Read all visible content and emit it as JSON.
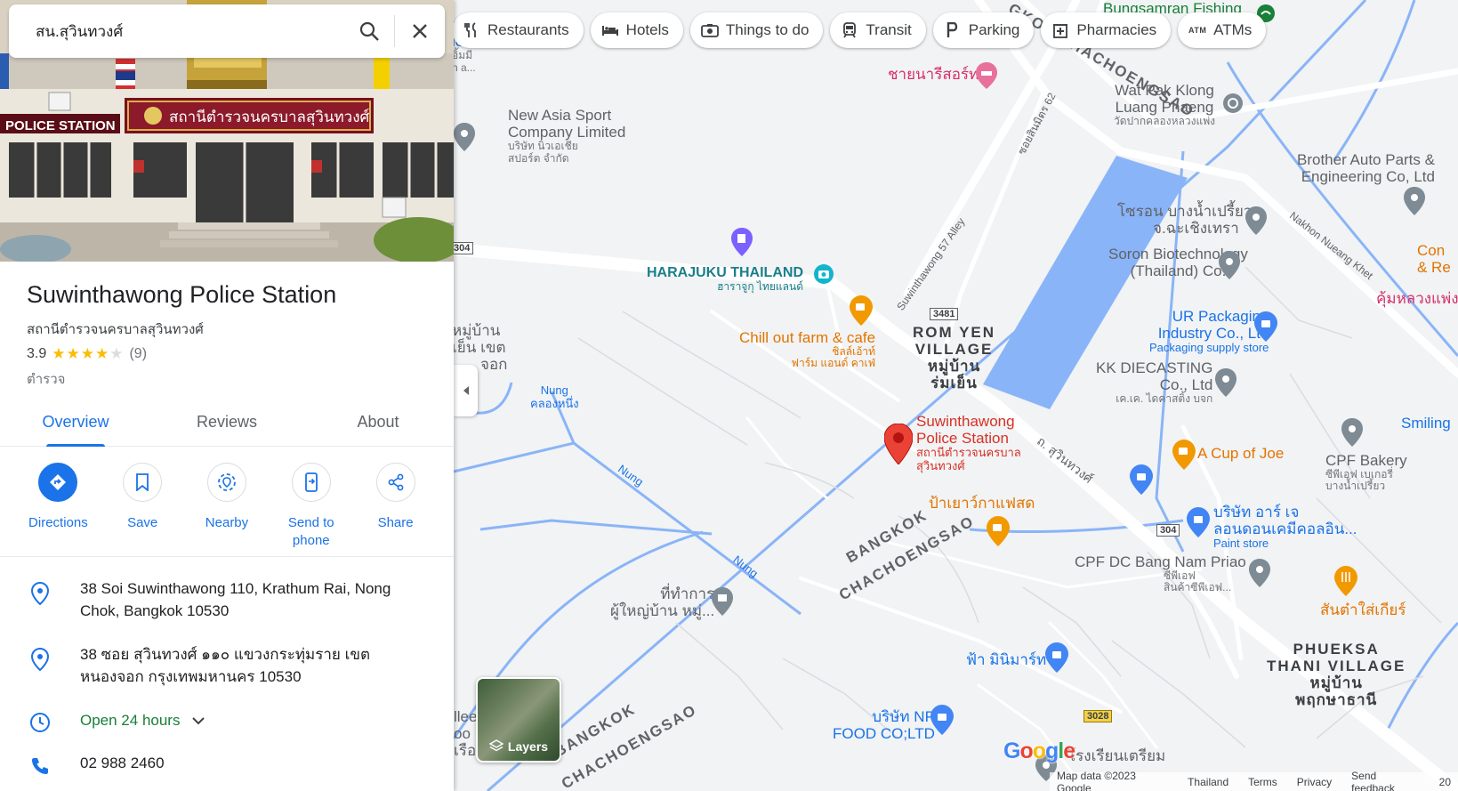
{
  "search": {
    "query": "สน.สุวินทวงศ์"
  },
  "chips": [
    {
      "label": "Restaurants",
      "icon": "restaurant-icon"
    },
    {
      "label": "Hotels",
      "icon": "hotel-icon"
    },
    {
      "label": "Things to do",
      "icon": "camera-icon"
    },
    {
      "label": "Transit",
      "icon": "transit-icon"
    },
    {
      "label": "Parking",
      "icon": "parking-icon"
    },
    {
      "label": "Pharmacies",
      "icon": "pharmacy-icon"
    },
    {
      "label": "ATMs",
      "icon": "atm-icon",
      "icon_text": "ATM"
    }
  ],
  "photo": {
    "sign_th": "สถานีตำรวจนครบาลสุวินทวงศ์",
    "sign_en": "POLICE STATION"
  },
  "place": {
    "title": "Suwinthawong Police Station",
    "subtitle": "สถานีตำรวจนครบาลสุวินทวงศ์",
    "rating": "3.9",
    "stars": 3.9,
    "reviews_count": "(9)",
    "category": "ตำรวจ"
  },
  "tabs": [
    {
      "label": "Overview",
      "active": true
    },
    {
      "label": "Reviews",
      "active": false
    },
    {
      "label": "About",
      "active": false
    }
  ],
  "actions": [
    {
      "label": "Directions",
      "icon": "directions-icon"
    },
    {
      "label": "Save",
      "icon": "bookmark-icon"
    },
    {
      "label": "Nearby",
      "icon": "nearby-icon"
    },
    {
      "label": "Send to phone",
      "icon": "send-to-phone-icon"
    },
    {
      "label": "Share",
      "icon": "share-icon"
    }
  ],
  "info": {
    "address_en": "38 Soi Suwinthawong 110, Krathum Rai, Nong Chok, Bangkok 10530",
    "address_th": "38 ซอย สุวินทวงศ์ ๑๑๐ แขวงกระทุ่มราย เขตหนองจอก กรุงเทพมหานคร 10530",
    "hours": "Open 24 hours",
    "phone": "02 988 2460"
  },
  "map": {
    "labels": {
      "bungsamran": "Bungsamran Fishing",
      "chainari": "ชายนารีสอร์ท",
      "wat_pak_en1": "Wat Pak Klong",
      "wat_pak_en2": "Luang Phaeng",
      "wat_pak_th": "วัดปากคลองหลวงแพ่ง",
      "new_asia1": "New Asia Sport",
      "new_asia2": "Company Limited",
      "new_asia_th1": "บริษัท นิวเอเชีย",
      "new_asia_th2": "สปอร์ต จำกัด",
      "brother1": "Brother Auto Parts &",
      "brother2": "Engineering Co, Ltd",
      "soi62": "ซอยสินมิตร 62",
      "sorn_th1": "โซรอน บางน้ำเปรี้ยว",
      "sorn_th2": "จ.ฉะเชิงเทรา",
      "soron1": "Soron Biotechnology",
      "soron2": "(Thailand) Co.",
      "harajuku": "HARAJUKU THAILAND",
      "harajuku_th": "ฮาราจูกุ ไทยแลนด์",
      "alley57": "Suwinthawong 57 Alley",
      "shield_3481": "3481",
      "shield_304a": "304",
      "shield_304b": "304",
      "shield_3028": "3028",
      "rom_yen1": "ROM YEN",
      "rom_yen2": "VILLAGE",
      "rom_yen_th1": "หมู่บ้าน",
      "rom_yen_th2": "ร่มเย็น",
      "chill1": "Chill out farm & cafe",
      "chill_th1": "ชิลล์เอ้าท์",
      "chill_th2": "ฟาร์ม แอนด์ คาเฟ่",
      "ur1": "UR Packaging",
      "ur2": "Industry Co., Ltd",
      "ur3": "Packaging supply store",
      "kk1": "KK DIECASTING",
      "kk2": "Co., Ltd",
      "kk_th": "เค.เค. ไดคาสติ้ง บจก",
      "nung": "Nung",
      "nung_th": "คลองหนึ่ง",
      "nung2": "Nung",
      "nung3": "Nung",
      "moo_left1": "หมู่บ้าน",
      "moo_left2": "เย็น เขต",
      "moo_left3": "จอก",
      "poi_title1": "Suwinthawong",
      "poi_title2": "Police Station",
      "poi_th1": "สถานีตำรวจนครบาล",
      "poi_th2": "สุวินทวงศ์",
      "suwin_road": "ถ. สุวินทวงศ์",
      "cup_joe": "A Cup of Joe",
      "cpf_bakery": "CPF Bakery",
      "cpf_bakery_th1": "ซีพีเอฟ เบเกอรี่",
      "cpf_bakery_th2": "บางน้ำเปรี้ยว",
      "smiling": "Smiling",
      "con1": "Con",
      "con2": "& Re",
      "khum": "คุ้มหลวงแพ่ง",
      "nakhon_khet": "Nakhon Nueang Khet",
      "payao": "ป้าเยาว์กาแฟสด",
      "bangkok1": "BANGKOK",
      "chachoengsao1": "CHACHOENGSAO",
      "bangkok2": "BANGKOK",
      "chachoengsao2": "CHACHOENGSAO",
      "ar_j1": "บริษัท อาร์ เจ",
      "ar_j2": "ลอนดอนเคมีคอลอิน...",
      "ar_j3": "Paint store",
      "cpf_dc1": "CPF DC Bang Nam Priao",
      "cpf_dc_th1": "ซีพีเอฟ",
      "cpf_dc_th2": "สินค้าซีพีเอฟ...",
      "teekam1": "ที่ทำการ",
      "teekam2": "ผู้ใหญ่บ้าน หมู่...",
      "santai": "สันต๋าใส่เกียร์",
      "phueksa1": "PHUEKSA",
      "phueksa2": "THANI VILLAGE",
      "phueksa_th1": "หมู่บ้าน",
      "phueksa_th2": "พฤกษาธานี",
      "fah": "ฟ้า มินิมาร์ท",
      "np1": "บริษัท NP",
      "np2": "FOOD CO;LTD",
      "school": "โรงเรียนเตรียม",
      "left_edge1": "rks",
      "left_edge2": "ice",
      "left_edge3": "อิ้มมี",
      "left_edge4": "n a...",
      "left_bottom1": "llee",
      "left_bottom2": "oo",
      "left_bottom3": "เรือน",
      "top_gksao": "GKOK CHACHOENGSAO"
    },
    "layers_label": "Layers",
    "google": [
      "G",
      "o",
      "o",
      "g",
      "l",
      "e"
    ],
    "footer": [
      "Map data ©2023 Google",
      "Thailand",
      "Terms",
      "Privacy",
      "Send feedback",
      "20"
    ]
  },
  "colors": {
    "accent": "#1a73e8",
    "pin_red": "#ea4335",
    "water": "#8ab4f8",
    "star": "#fbbc04",
    "open_green": "#188038"
  }
}
